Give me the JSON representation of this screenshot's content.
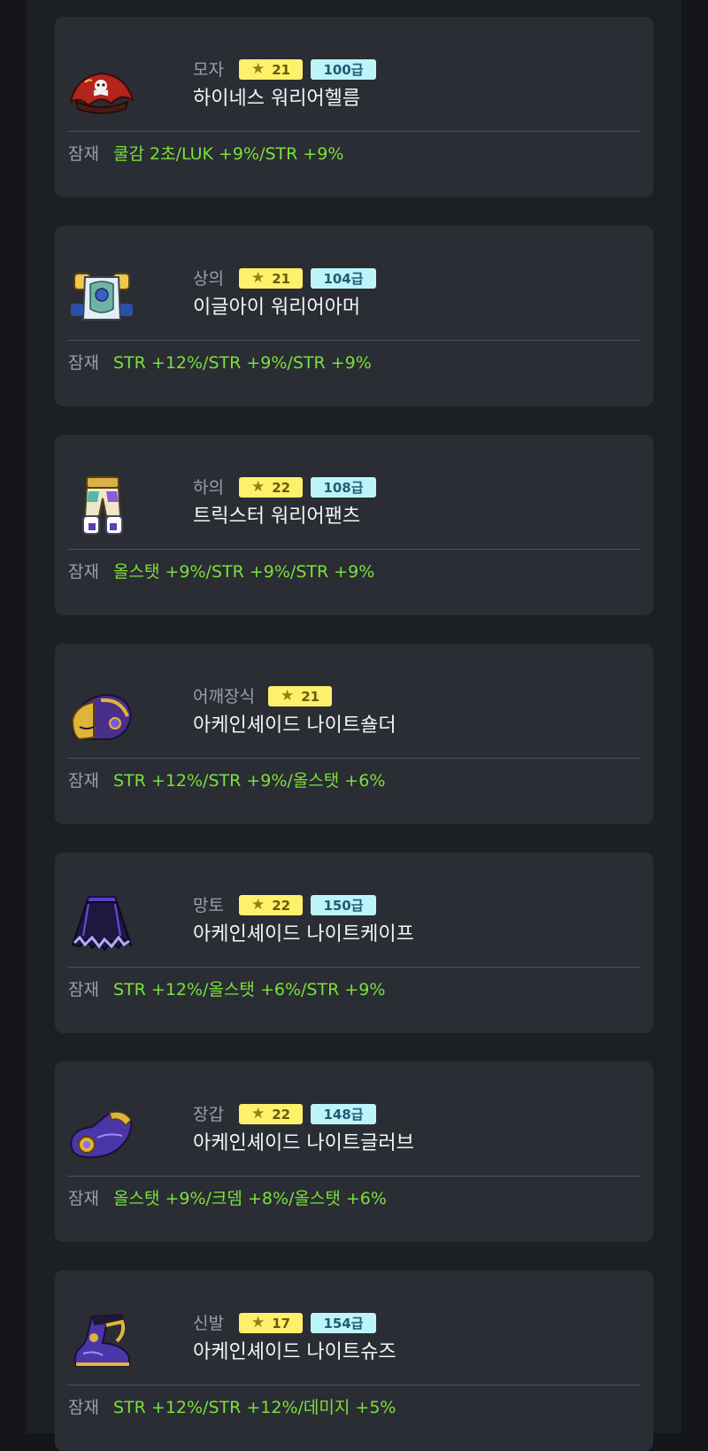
{
  "colors": {
    "page_background": "#141619",
    "column_background": "#1c1f23",
    "card_background": "#2a2d34",
    "star_badge": "#fff06b",
    "level_badge": "#bdf4fb",
    "potential_text": "#7be03a"
  },
  "items": [
    {
      "slot": "모자",
      "stars": "21",
      "level": "100급",
      "name": "하이네스 워리어헬름",
      "potential_label": "잠재",
      "potential": "쿨감 2초/LUK +9%/STR +9%",
      "icon": "pirate-hat-icon"
    },
    {
      "slot": "상의",
      "stars": "21",
      "level": "104급",
      "name": "이글아이 워리어아머",
      "potential_label": "잠재",
      "potential": "STR +12%/STR +9%/STR +9%",
      "icon": "armor-top-icon"
    },
    {
      "slot": "하의",
      "stars": "22",
      "level": "108급",
      "name": "트릭스터 워리어팬츠",
      "potential_label": "잠재",
      "potential": "올스탯 +9%/STR +9%/STR +9%",
      "icon": "pants-icon"
    },
    {
      "slot": "어깨장식",
      "stars": "21",
      "level": "",
      "name": "아케인셰이드 나이트숄더",
      "potential_label": "잠재",
      "potential": "STR +12%/STR +9%/올스탯 +6%",
      "icon": "shoulder-icon"
    },
    {
      "slot": "망토",
      "stars": "22",
      "level": "150급",
      "name": "아케인셰이드 나이트케이프",
      "potential_label": "잠재",
      "potential": "STR +12%/올스탯 +6%/STR +9%",
      "icon": "cape-icon"
    },
    {
      "slot": "장갑",
      "stars": "22",
      "level": "148급",
      "name": "아케인셰이드 나이트글러브",
      "potential_label": "잠재",
      "potential": "올스탯 +9%/크뎀 +8%/올스탯 +6%",
      "icon": "glove-icon"
    },
    {
      "slot": "신발",
      "stars": "17",
      "level": "154급",
      "name": "아케인셰이드 나이트슈즈",
      "potential_label": "잠재",
      "potential": "STR +12%/STR +12%/데미지 +5%",
      "icon": "boots-icon"
    }
  ]
}
